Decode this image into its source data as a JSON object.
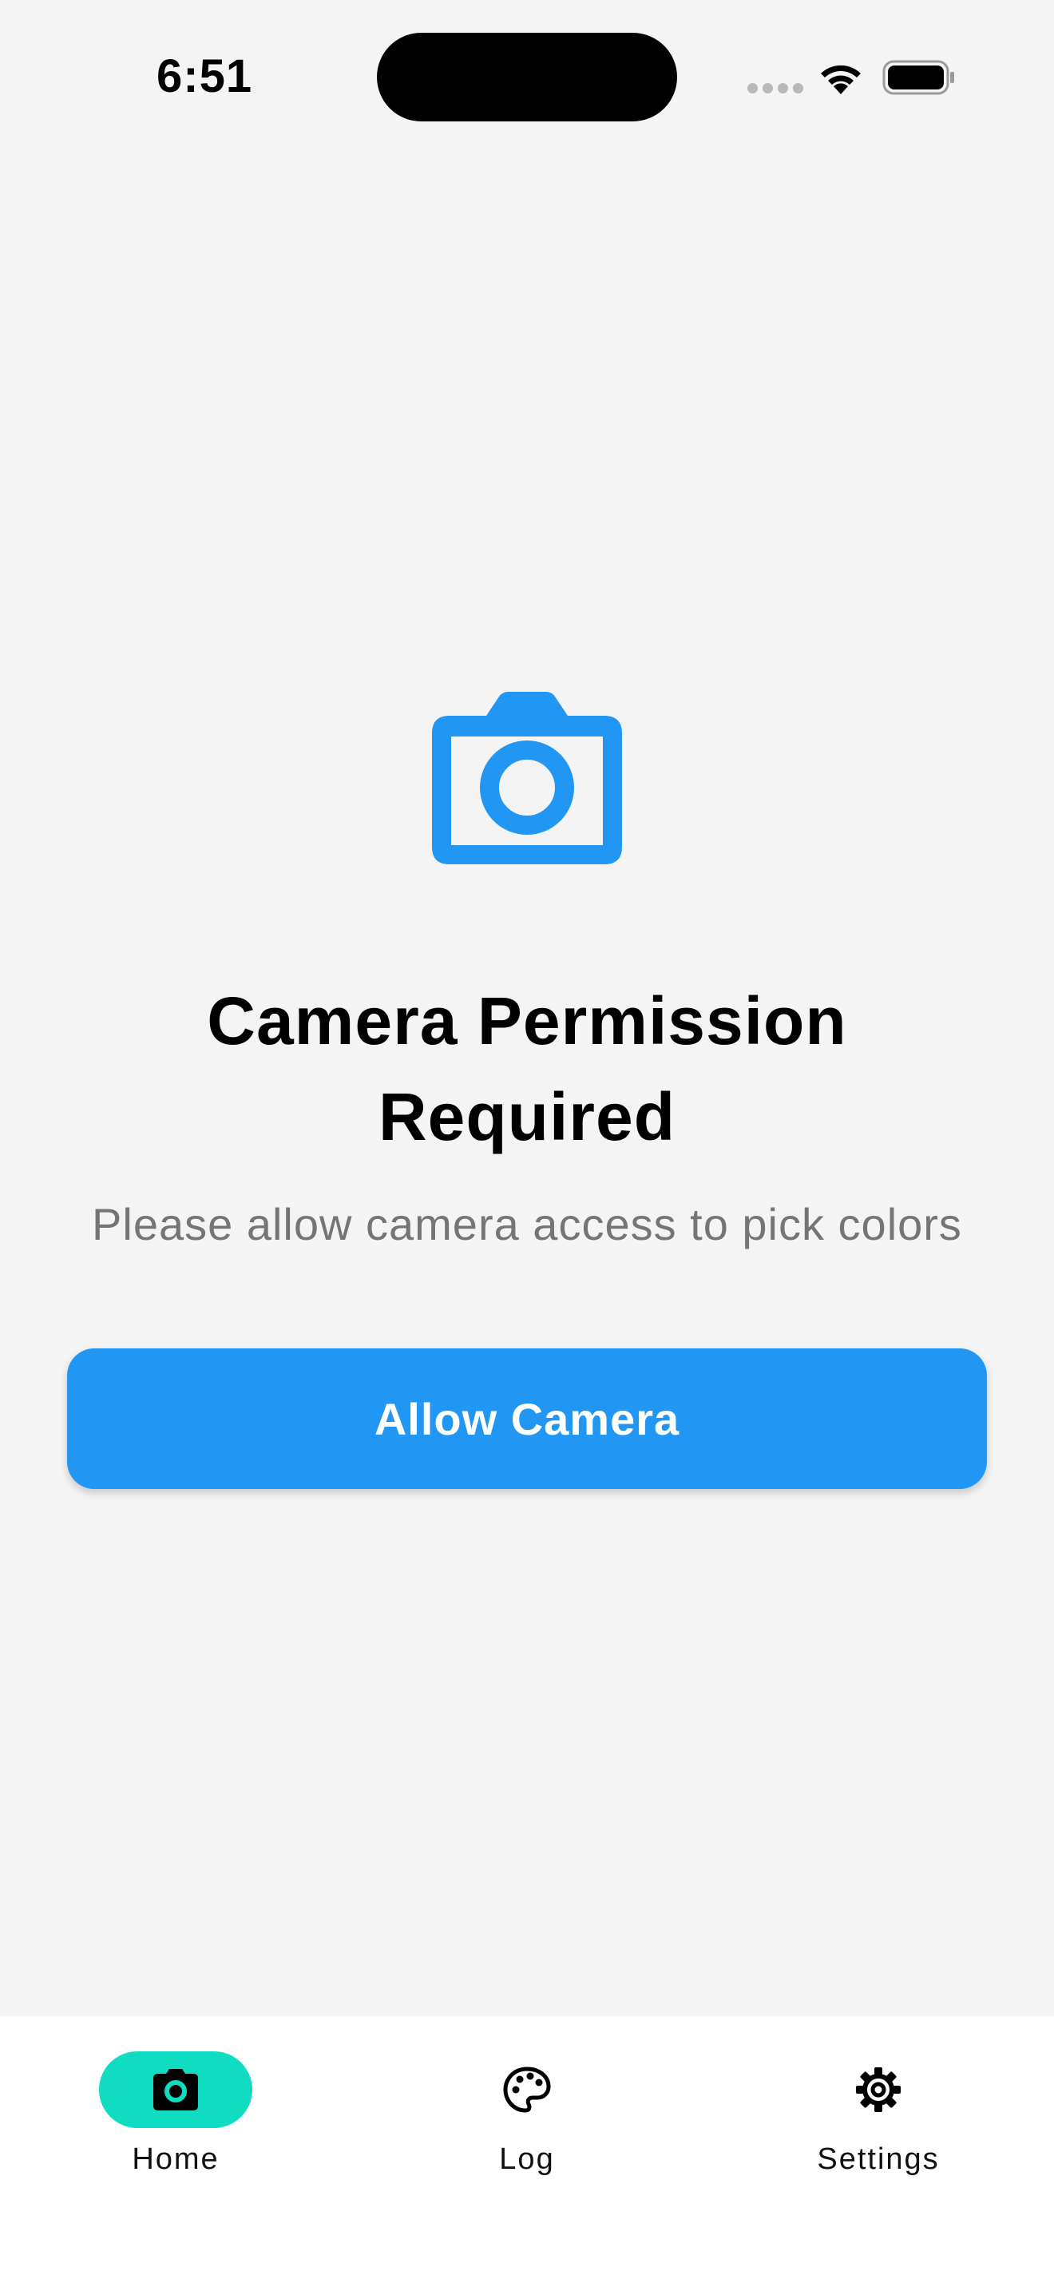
{
  "status_bar": {
    "time": "6:51"
  },
  "colors": {
    "accent": "#2196F3",
    "nav_active": "#10DCC2",
    "background": "#F4F4F4"
  },
  "permission": {
    "icon": "camera-icon",
    "title_line1": "Camera Permission",
    "title_line2": "Required",
    "subtitle": "Please allow camera access to pick colors",
    "button_label": "Allow Camera"
  },
  "bottom_nav": {
    "items": [
      {
        "label": "Home",
        "icon": "camera-icon",
        "active": true
      },
      {
        "label": "Log",
        "icon": "palette-icon",
        "active": false
      },
      {
        "label": "Settings",
        "icon": "gear-icon",
        "active": false
      }
    ]
  }
}
